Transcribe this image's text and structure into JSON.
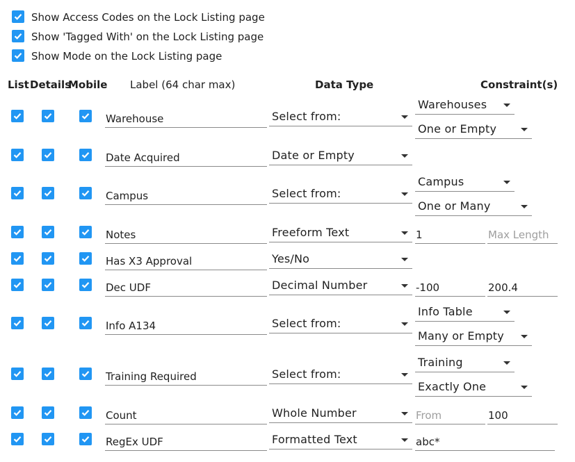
{
  "options": [
    {
      "label": "Show Access Codes on the Lock Listing page",
      "checked": true
    },
    {
      "label": "Show 'Tagged With' on the Lock Listing page",
      "checked": true
    },
    {
      "label": "Show Mode on the Lock Listing page",
      "checked": true
    }
  ],
  "headers": {
    "list": "List",
    "details": "Details",
    "mobile": "Mobile",
    "label": "Label (64 char max)",
    "data_type": "Data Type",
    "constraints": "Constraint(s)"
  },
  "rows": [
    {
      "label": "Warehouse",
      "data_type": "Select from:",
      "constraint_select_1": "Warehouses",
      "constraint_select_2": "One or Empty"
    },
    {
      "label": "Date Acquired",
      "data_type": "Date or Empty"
    },
    {
      "label": "Campus",
      "data_type": "Select from:",
      "constraint_select_1": "Campus",
      "constraint_select_2": "One or Many"
    },
    {
      "label": "Notes",
      "data_type": "Freeform Text",
      "min_value": "1",
      "max_placeholder": "Max Length"
    },
    {
      "label": "Has X3 Approval",
      "data_type": "Yes/No"
    },
    {
      "label": "Dec UDF",
      "data_type": "Decimal Number",
      "min_value": "-100",
      "max_value": "200.4"
    },
    {
      "label": "Info A134",
      "data_type": "Select from:",
      "constraint_select_1": "Info Table",
      "constraint_select_2": "Many or Empty"
    },
    {
      "label": "Training Required",
      "data_type": "Select from:",
      "constraint_select_1": "Training",
      "constraint_select_2": "Exactly One"
    },
    {
      "label": "Count",
      "data_type": "Whole Number",
      "min_placeholder": "From",
      "max_value": "100"
    },
    {
      "label": "RegEx UDF",
      "data_type": "Formatted Text",
      "pattern_value": "abc*"
    }
  ],
  "colors": {
    "checkbox": "#2196f3",
    "underline": "#8a8a8a"
  }
}
